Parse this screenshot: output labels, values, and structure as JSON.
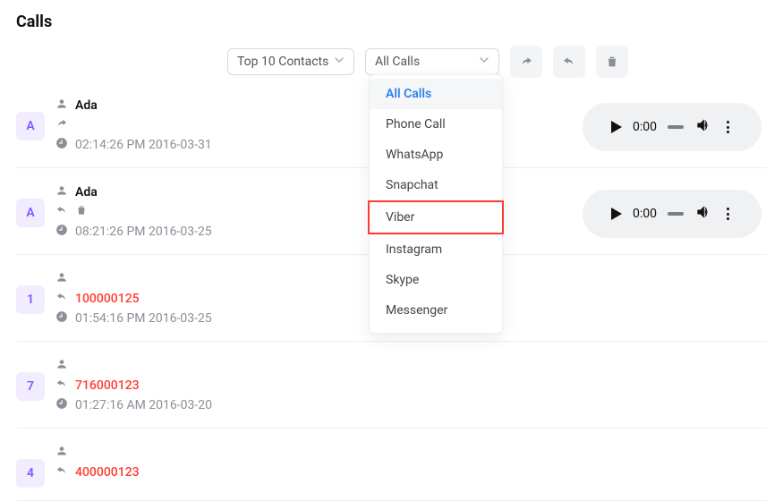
{
  "title": "Calls",
  "toolbar": {
    "contacts_select": "Top 10 Contacts",
    "filter_select": "All Calls"
  },
  "dropdown": {
    "items": [
      {
        "label": "All Calls",
        "selected": true
      },
      {
        "label": "Phone Call"
      },
      {
        "label": "WhatsApp"
      },
      {
        "label": "Snapchat"
      },
      {
        "label": "Viber",
        "highlight": true
      },
      {
        "label": "Instagram"
      },
      {
        "label": "Skype"
      },
      {
        "label": "Messenger"
      }
    ]
  },
  "audio_time": "0:00",
  "calls": [
    {
      "avatar": "A",
      "name": "Ada",
      "direction": "outgoing",
      "trash": false,
      "time": "02:14:26 PM 2016-03-31",
      "missed": false,
      "has_audio": true
    },
    {
      "avatar": "A",
      "name": "Ada",
      "direction": "incoming",
      "trash": true,
      "time": "08:21:26 PM 2016-03-25",
      "missed": false,
      "has_audio": true
    },
    {
      "avatar": "1",
      "name": "100000125",
      "direction": "incoming",
      "trash": false,
      "time": "01:54:16 PM 2016-03-25",
      "missed": true,
      "has_audio": false
    },
    {
      "avatar": "7",
      "name": "716000123",
      "direction": "incoming",
      "trash": false,
      "time": "01:27:16 AM 2016-03-20",
      "missed": true,
      "has_audio": false
    },
    {
      "avatar": "4",
      "name": "400000123",
      "direction": "incoming",
      "trash": false,
      "time": "",
      "missed": true,
      "has_audio": false
    }
  ]
}
